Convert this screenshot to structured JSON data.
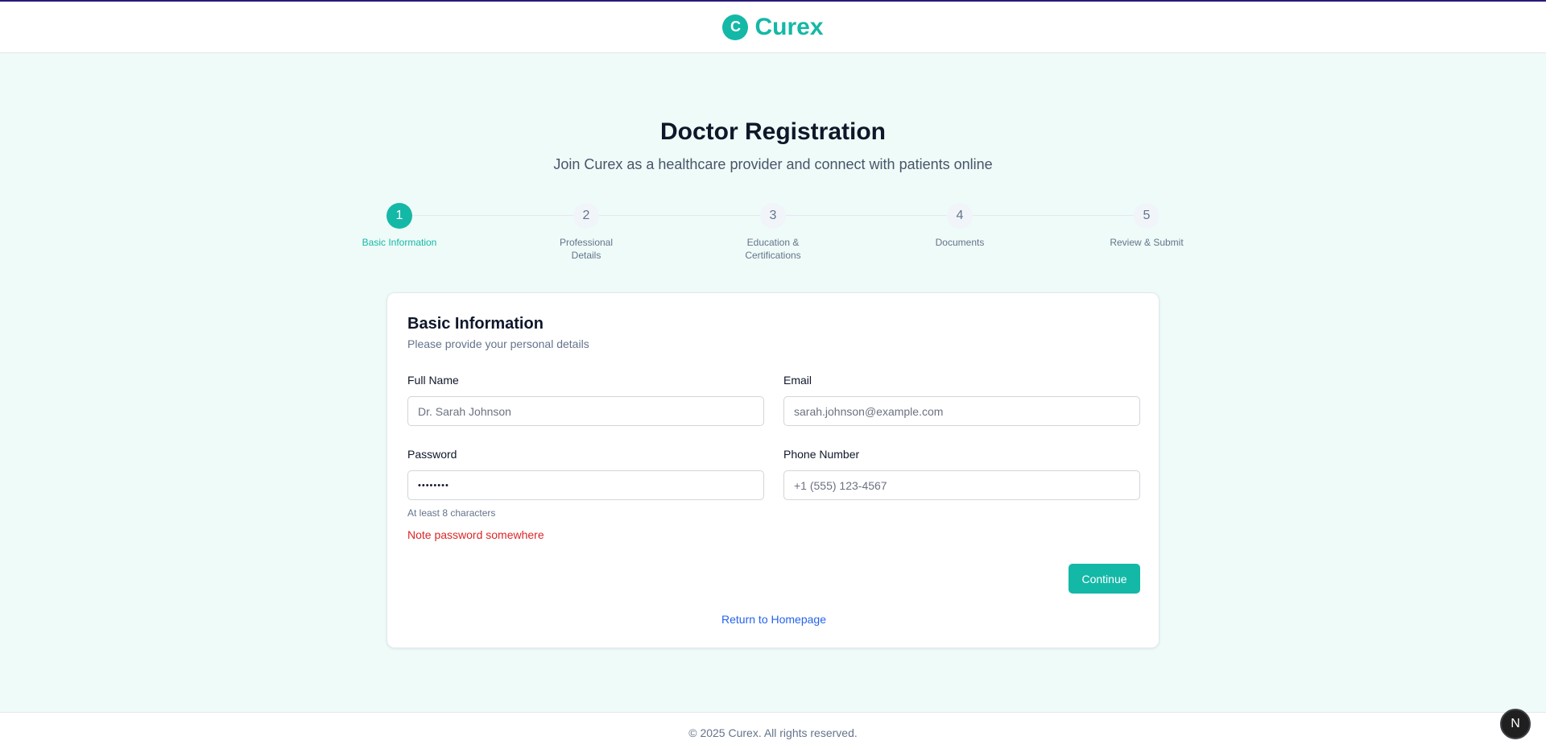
{
  "header": {
    "logo_letter": "C",
    "brand_name": "Curex"
  },
  "page": {
    "title": "Doctor Registration",
    "subtitle": "Join Curex as a healthcare provider and connect with patients online"
  },
  "stepper": {
    "active_step": 1,
    "steps": [
      {
        "number": "1",
        "label": "Basic Information"
      },
      {
        "number": "2",
        "label": "Professional Details"
      },
      {
        "number": "3",
        "label": "Education & Certifications"
      },
      {
        "number": "4",
        "label": "Documents"
      },
      {
        "number": "5",
        "label": "Review & Submit"
      }
    ]
  },
  "form": {
    "title": "Basic Information",
    "description": "Please provide your personal details",
    "full_name": {
      "label": "Full Name",
      "placeholder": "Dr. Sarah Johnson",
      "value": ""
    },
    "email": {
      "label": "Email",
      "placeholder": "sarah.johnson@example.com",
      "value": ""
    },
    "password": {
      "label": "Password",
      "value": "••••••••",
      "hint": "At least 8 characters",
      "warning": "Note password somewhere"
    },
    "phone": {
      "label": "Phone Number",
      "placeholder": "+1 (555) 123-4567",
      "value": ""
    },
    "continue_label": "Continue",
    "home_link_label": "Return to Homepage"
  },
  "footer": {
    "copyright": "© 2025 Curex. All rights reserved."
  },
  "dev_badge": {
    "letter": "N"
  },
  "colors": {
    "accent": "#14b8a6",
    "warning": "#dc2626",
    "link": "#2563eb",
    "background": "#effbf8"
  }
}
